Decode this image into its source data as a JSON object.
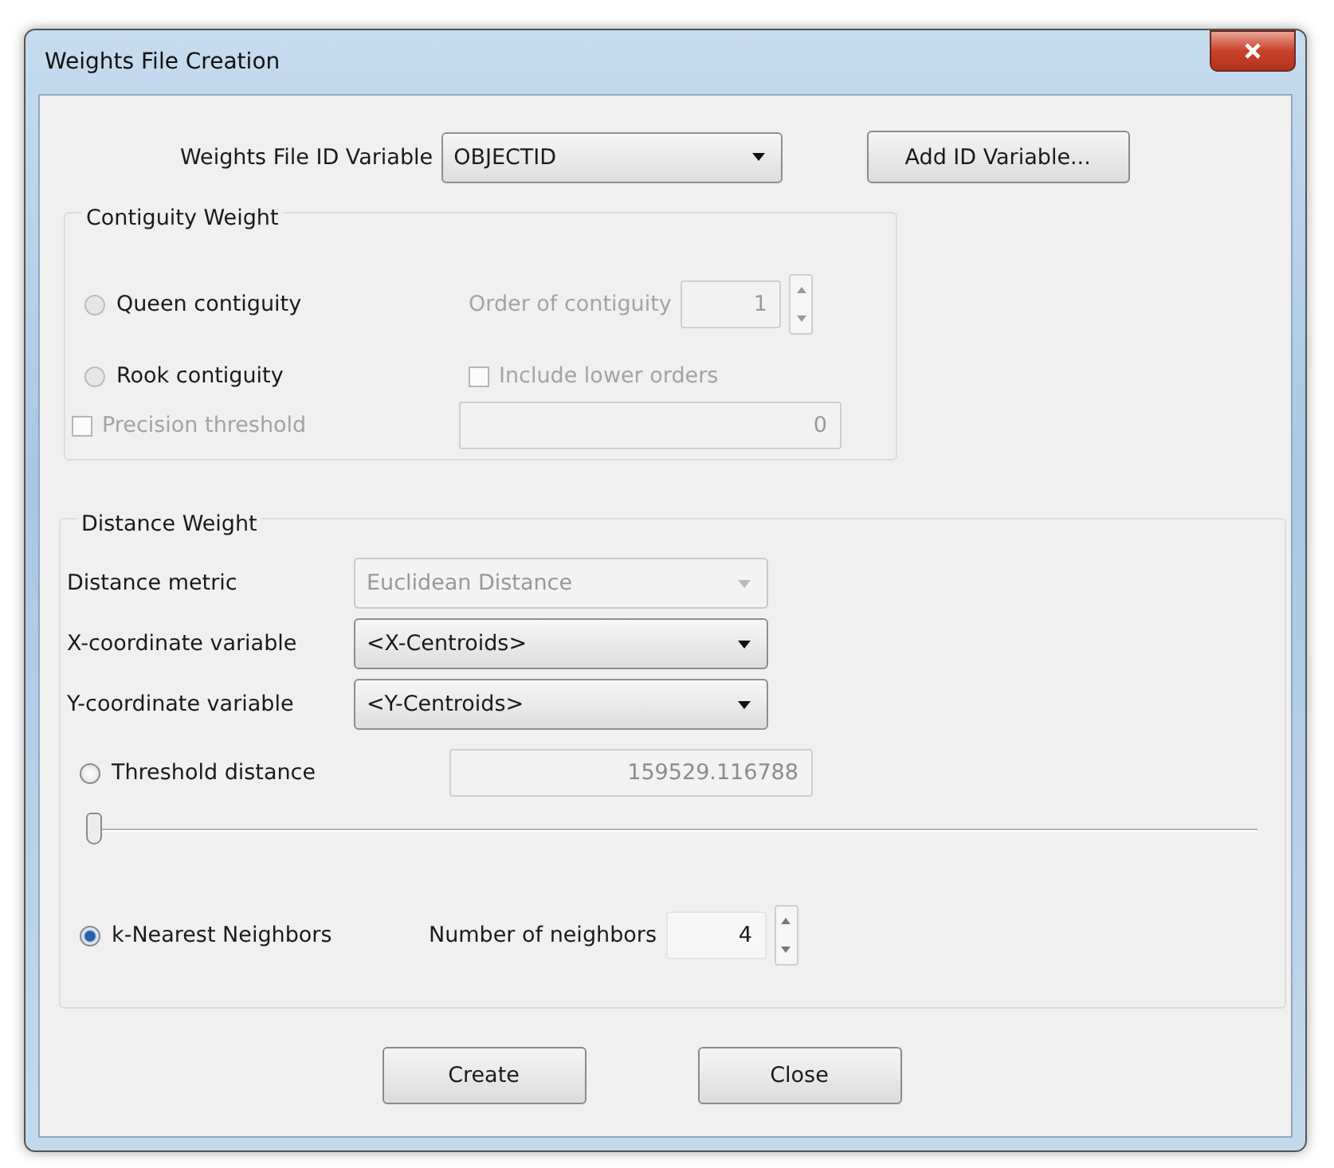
{
  "window": {
    "title": "Weights File Creation"
  },
  "id_variable": {
    "label": "Weights File ID Variable",
    "value": "OBJECTID"
  },
  "add_button": "Add ID Variable...",
  "contiguity": {
    "title": "Contiguity Weight",
    "disabled": true,
    "queen": {
      "label": "Queen contiguity",
      "selected": false
    },
    "order": {
      "label": "Order of contiguity",
      "value": "1"
    },
    "rook": {
      "label": "Rook contiguity",
      "selected": false
    },
    "include_lower": {
      "label": "Include lower orders",
      "checked": false
    },
    "precision": {
      "label": "Precision threshold",
      "checked": false,
      "value": "0"
    }
  },
  "distance": {
    "title": "Distance Weight",
    "metric": {
      "label": "Distance metric",
      "value": "Euclidean Distance",
      "disabled": true
    },
    "x_variable": {
      "label": "X-coordinate variable",
      "value": "<X-Centroids>"
    },
    "y_variable": {
      "label": "Y-coordinate variable",
      "value": "<Y-Centroids>"
    },
    "threshold": {
      "label": "Threshold distance",
      "selected": false,
      "value": "159529.116788",
      "level": 0
    },
    "knn": {
      "label": "k-Nearest Neighbors",
      "selected": true,
      "neighbors_label": "Number of neighbors",
      "value": "4"
    }
  },
  "buttons": [
    "Create",
    "Close"
  ]
}
